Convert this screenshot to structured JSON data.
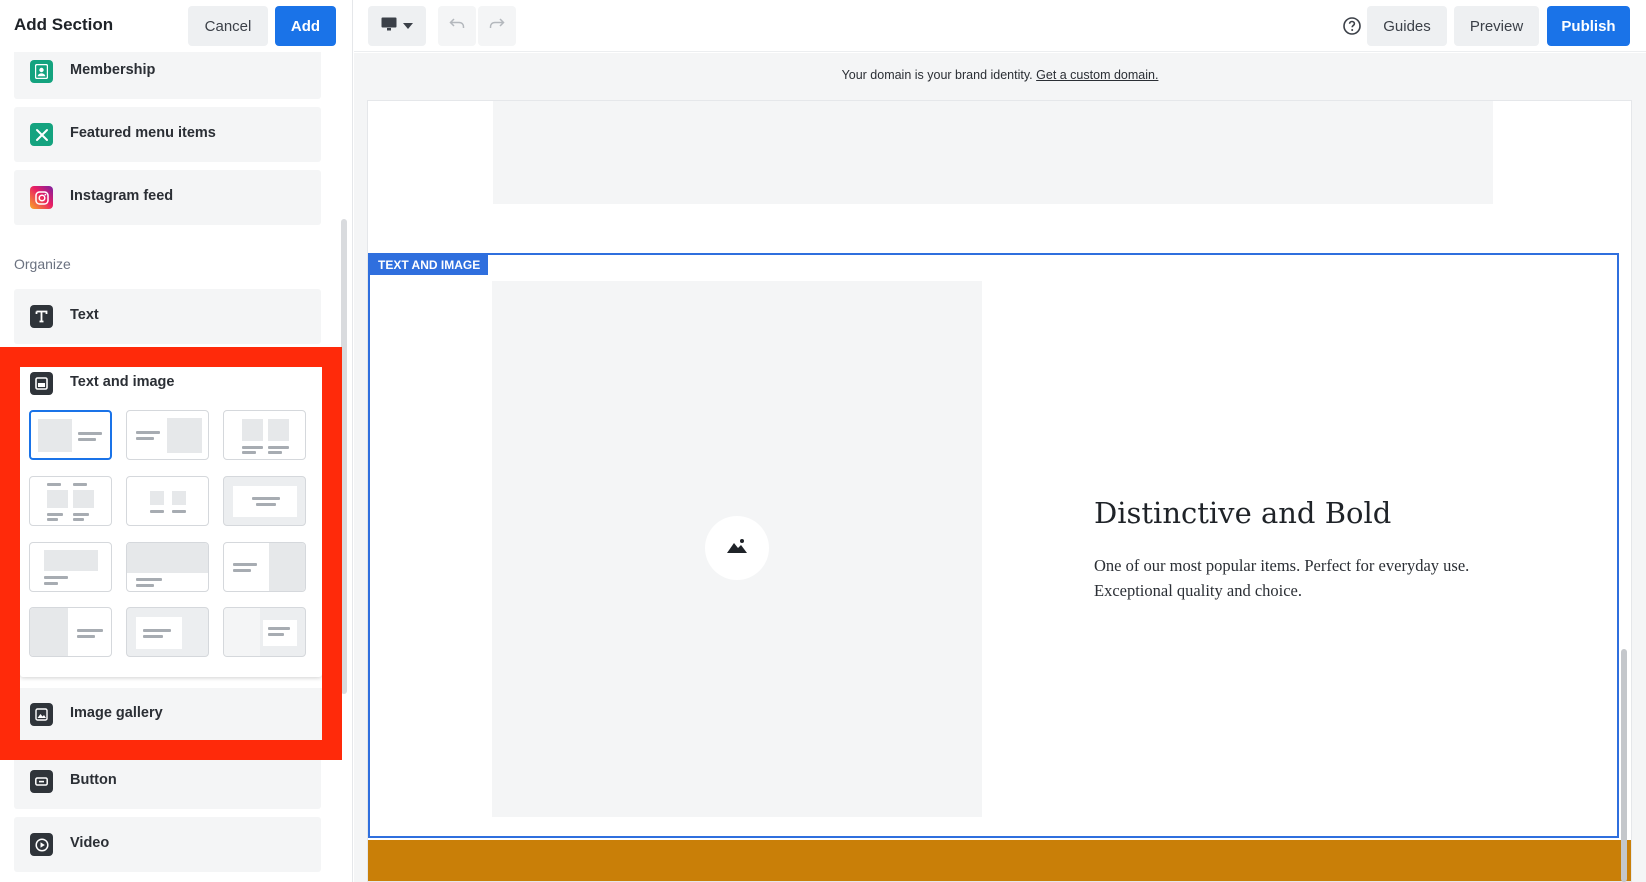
{
  "panel": {
    "title": "Add Section",
    "cancel_label": "Cancel",
    "add_label": "Add",
    "items_top": [
      {
        "label": "Membership",
        "icon": "membership-icon"
      },
      {
        "label": "Featured menu items",
        "icon": "featured-menu-icon"
      },
      {
        "label": "Instagram feed",
        "icon": "instagram-icon"
      }
    ],
    "organize_label": "Organize",
    "text_item": "Text",
    "text_image_item": "Text and image",
    "image_gallery_item": "Image gallery",
    "button_item": "Button",
    "video_item": "Video"
  },
  "toolbar": {
    "guides_label": "Guides",
    "preview_label": "Preview",
    "publish_label": "Publish"
  },
  "banner": {
    "text": "Your domain is your brand identity.",
    "link": "Get a custom domain."
  },
  "section": {
    "tag": "TEXT AND IMAGE",
    "heading": "Distinctive and Bold",
    "body": "One of our most popular items. Perfect for everyday use. Exceptional quality and choice."
  },
  "colors": {
    "accent": "#1a73e8",
    "highlight": "#ff2a0a",
    "band": "#c97f08"
  }
}
